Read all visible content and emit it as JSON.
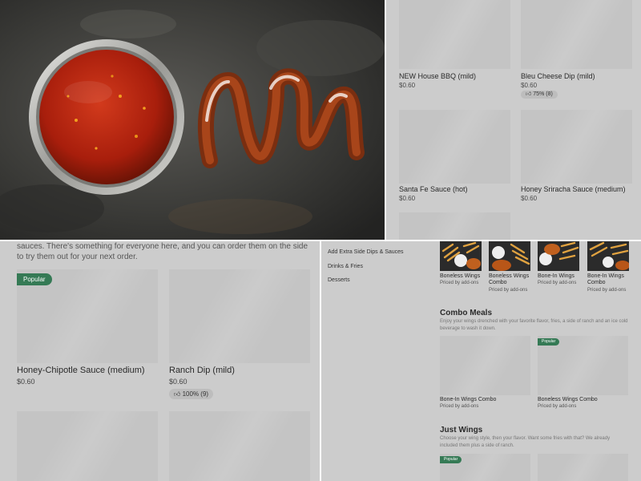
{
  "menu_items_top": [
    {
      "name": "NEW House BBQ (mild)",
      "price": "$0.60"
    },
    {
      "name": "Bleu Cheese Dip (mild)",
      "price": "$0.60",
      "rating": "75% (8)"
    },
    {
      "name": "Santa Fe Sauce (hot)",
      "price": "$0.60"
    },
    {
      "name": "Honey Sriracha Sauce (medium)",
      "price": "$0.60"
    }
  ],
  "sauces_section": {
    "description": "sauces. There's something for everyone here, and you can order them on the side to try them out for your next order.",
    "popular_label": "Popular",
    "items": [
      {
        "name": "Honey-Chipotle Sauce (medium)",
        "price": "$0.60"
      },
      {
        "name": "Ranch Dip (mild)",
        "price": "$0.60",
        "rating": "100% (9)"
      }
    ]
  },
  "side_nav": [
    "Add Extra Side Dips & Sauces",
    "Drinks & Fries",
    "Desserts"
  ],
  "wings_row": [
    {
      "name": "Boneless Wings",
      "price": "Priced by add-ons"
    },
    {
      "name": "Boneless Wings Combo",
      "price": "Priced by add-ons"
    },
    {
      "name": "Bone-In Wings",
      "price": "Priced by add-ons"
    },
    {
      "name": "Bone-In Wings Combo",
      "price": "Priced by add-ons"
    }
  ],
  "combo_meals": {
    "title": "Combo Meals",
    "description": "Enjoy your wings drenched with your favorite flavor, fries, a side of ranch and an ice cold beverage to wash it down.",
    "popular_label": "Popular",
    "items": [
      {
        "name": "Bone-In Wings Combo",
        "price": "Priced by add-ons"
      },
      {
        "name": "Boneless Wings Combo",
        "price": "Priced by add-ons"
      }
    ]
  },
  "just_wings": {
    "title": "Just Wings",
    "description": "Choose your wing style, then your flavor. Want some fries with that? We already included them plus a side of ranch.",
    "popular_label": "Popular"
  },
  "icons": {
    "rating": "thumbs-up-icon"
  },
  "colors": {
    "accent": "#357a55",
    "overlay": "#cccccc",
    "sauce": "#a3210f"
  }
}
